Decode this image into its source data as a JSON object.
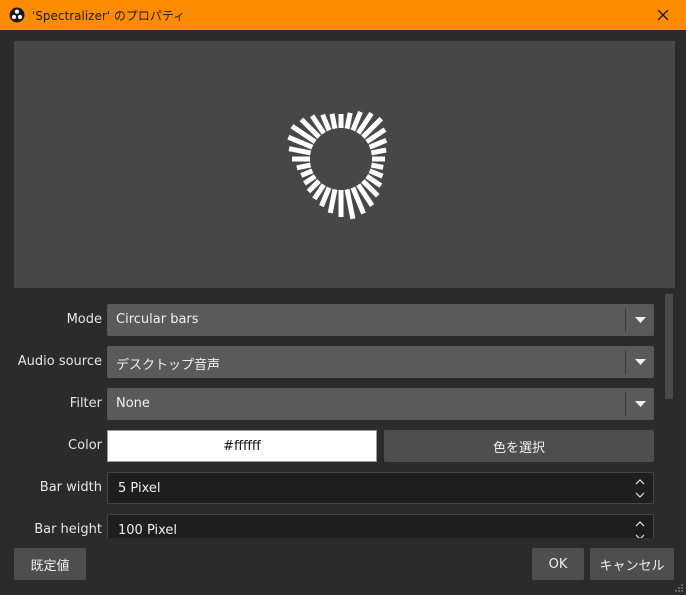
{
  "window": {
    "title": "'Spectralizer' のプロパティ",
    "icon": "obs-logo-icon",
    "accent": "#ff8c00"
  },
  "preview": {
    "visualization": "circular-bars",
    "bar_color": "#ffffff",
    "background": "#474747"
  },
  "properties": {
    "mode": {
      "label": "Mode",
      "value": "Circular bars"
    },
    "audio_source": {
      "label": "Audio source",
      "value": "デスクトップ音声"
    },
    "filter": {
      "label": "Filter",
      "value": "None"
    },
    "color": {
      "label": "Color",
      "value": "#ffffff",
      "button_label": "色を選択"
    },
    "bar_width": {
      "label": "Bar width",
      "value": "5 Pixel"
    },
    "bar_height": {
      "label": "Bar height",
      "value": "100 Pixel"
    }
  },
  "buttons": {
    "defaults": "既定値",
    "ok": "OK",
    "cancel": "キャンセル"
  }
}
